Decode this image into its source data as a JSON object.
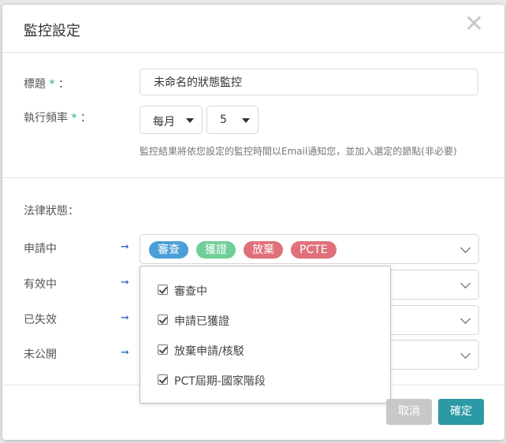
{
  "modal": {
    "title": "監控設定",
    "close_glyph": "✕"
  },
  "form": {
    "title_label": "標題",
    "title_value": "未命名的狀態監控",
    "frequency_label": "執行頻率",
    "required_mark": "*",
    "colon": "：",
    "frequency_unit": "每月",
    "frequency_day": "5",
    "hint": "監控結果將依您設定的監控時間以Email通知您，並加入選定的節點(非必要)"
  },
  "legal_status": {
    "section_label": "法律狀態：",
    "arrow_glyph": "➞",
    "rows": [
      {
        "label": "申請中"
      },
      {
        "label": "有效中"
      },
      {
        "label": "已失效"
      },
      {
        "label": "未公開"
      }
    ],
    "tags": [
      {
        "label": "審查",
        "color": "#4a9fd8"
      },
      {
        "label": "獲證",
        "color": "#6fcf97"
      },
      {
        "label": "放棄",
        "color": "#e0707a"
      },
      {
        "label": "PCTE",
        "color": "#e0707a"
      }
    ],
    "dropdown_options": [
      {
        "label": "審查中",
        "checked": true
      },
      {
        "label": "申請已獲證",
        "checked": true
      },
      {
        "label": "放棄申請/核駁",
        "checked": true
      },
      {
        "label": "PCT屆期-國家階段",
        "checked": true
      }
    ]
  },
  "footer": {
    "cancel_label": "取消",
    "confirm_label": "確定",
    "cancel_color": "#c8c8c8",
    "confirm_color": "#2b9aa5"
  }
}
